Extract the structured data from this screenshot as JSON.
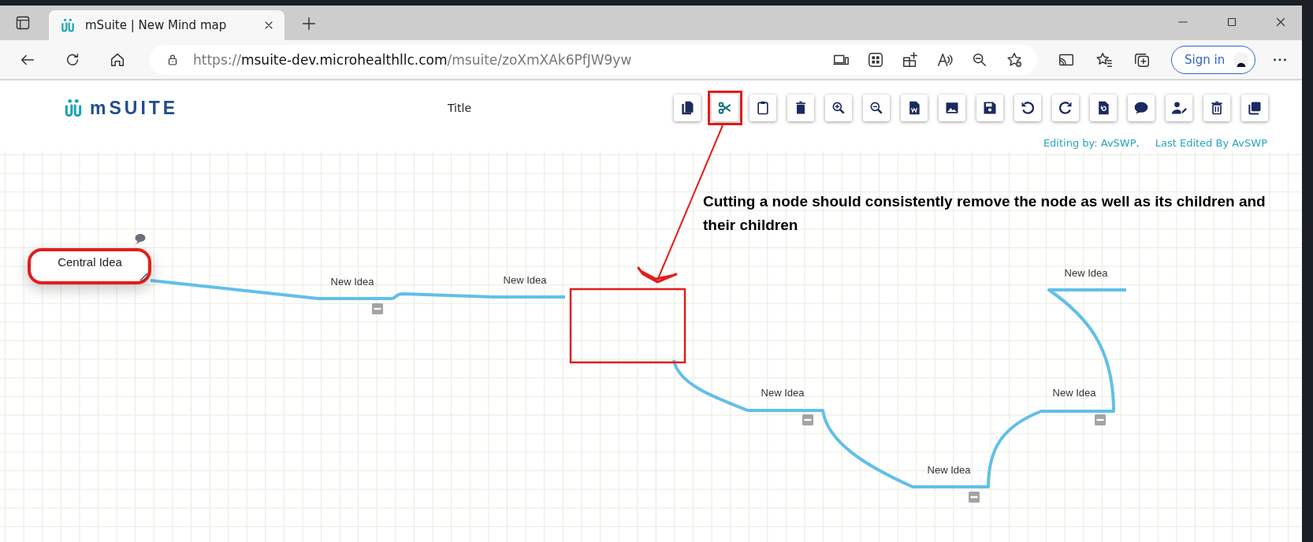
{
  "browser": {
    "tabs": [
      {
        "title": "mSuite | New Mind map",
        "selected": true
      }
    ],
    "address": {
      "scheme": "https://",
      "host": "msuite-dev.microhealthllc.com",
      "path": "/msuite/zoXmXAk6PfJW9yw"
    },
    "sign_in": "Sign in"
  },
  "header": {
    "logo": "mSUITE",
    "title": "Title",
    "toolbar": [
      {
        "kind": "copy",
        "highlighted": false
      },
      {
        "kind": "cut",
        "highlighted": true
      },
      {
        "kind": "paste",
        "highlighted": false
      },
      {
        "kind": "delete",
        "highlighted": false
      },
      {
        "kind": "zoom-in",
        "highlighted": false
      },
      {
        "kind": "zoom-out",
        "highlighted": false
      },
      {
        "kind": "export-word",
        "highlighted": false
      },
      {
        "kind": "export-image",
        "highlighted": false
      },
      {
        "kind": "save",
        "highlighted": false
      },
      {
        "kind": "undo",
        "highlighted": false
      },
      {
        "kind": "redo",
        "highlighted": false
      },
      {
        "kind": "restore",
        "highlighted": false
      },
      {
        "kind": "comment",
        "highlighted": false
      },
      {
        "kind": "edit-user",
        "highlighted": false
      },
      {
        "kind": "trash",
        "highlighted": false
      },
      {
        "kind": "duplicate",
        "highlighted": false
      }
    ],
    "editing_by": "Editing by: AvSWP,",
    "last_edited": "Last Edited By AvSWP"
  },
  "mind_map": {
    "central": {
      "text": "Central Idea",
      "highlighted": true,
      "has_comment": true
    },
    "nodes": [
      {
        "text": "New Idea",
        "collapsible": true
      },
      {
        "text": "New Idea",
        "collapsible": false
      },
      {
        "text": "New Idea",
        "collapsible": true
      },
      {
        "text": "New Idea",
        "collapsible": true
      },
      {
        "text": "New Idea",
        "collapsible": true
      },
      {
        "text": "New Idea",
        "collapsible": false
      }
    ],
    "annotation": "Cutting a node should consistently remove the node as well as its children and their children"
  }
}
